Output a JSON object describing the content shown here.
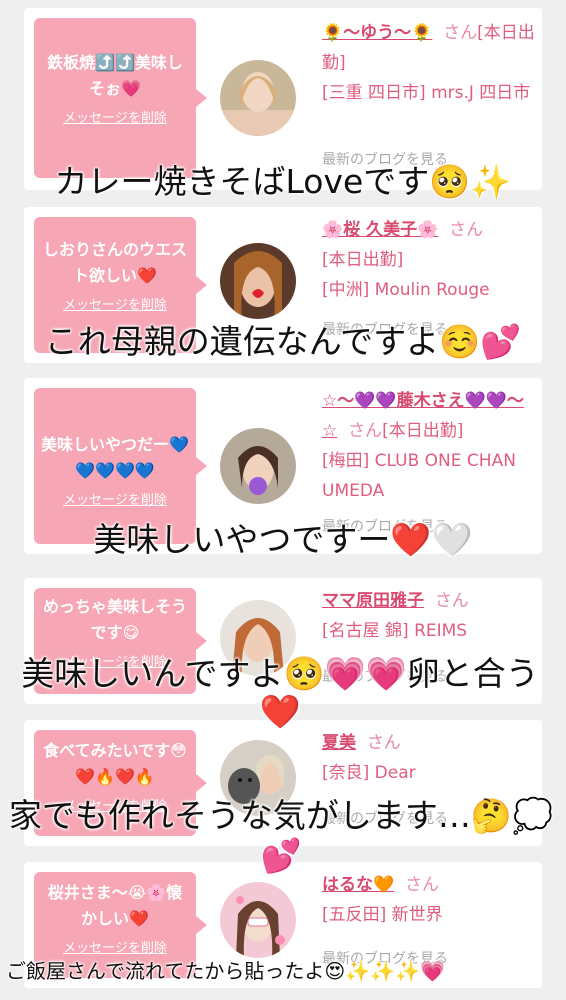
{
  "cards": [
    {
      "comment": "鉄板焼⤴️⤴️美味しそぉ💗",
      "delete_label": "メッセージを削除",
      "name": "🌻〜ゆう〜🌻",
      "honorific": "さん",
      "status": "[本日出勤]",
      "location": "[三重 四日市] mrs.J 四日市",
      "blog_link": "最新のブログを見る"
    },
    {
      "comment": "しおりさんのウエスト欲しい❤️",
      "delete_label": "メッセージを削除",
      "name": "🌸桜 久美子🌸",
      "honorific": "さん",
      "status": "[本日出勤]",
      "location": "[中洲] Moulin Rouge",
      "blog_link": "最新のブログを見る"
    },
    {
      "comment": "美味しいやつだー💙💙💙💙💙",
      "delete_label": "メッセージを削除",
      "name": "☆〜💜💜藤木さえ💜💜〜☆",
      "honorific": "さん",
      "status": "[本日出勤]",
      "location": "[梅田] CLUB ONE CHAN UMEDA",
      "blog_link": "最新のブログを見る"
    },
    {
      "comment": "めっちゃ美味しそうです😋",
      "delete_label": "メッセージを削除",
      "name": "ママ原田雅子",
      "honorific": "さん",
      "status": "",
      "location": "[名古屋 錦] REIMS",
      "blog_link": "最新のブログを見る"
    },
    {
      "comment": "食べてみたいです😳❤️🔥❤️🔥",
      "delete_label": "メッセージを削除",
      "name": "夏美",
      "honorific": "さん",
      "status": "",
      "location": "[奈良] Dear",
      "blog_link": "最新のブログを見る"
    },
    {
      "comment": "桜井さま〜😭🌸懐かしい❤️",
      "delete_label": "メッセージを削除",
      "name": "はるな🧡",
      "honorific": "さん",
      "status": "",
      "location": "[五反田] 新世界",
      "blog_link": "最新のブログを見る"
    }
  ],
  "captions": [
    "カレー焼きそばLoveです🥺✨",
    "これ母親の遺伝なんですよ☺️💕",
    "美味しいやつですー❤️🤍",
    "美味しいんですよ🥺💗💗卵と合う❤️",
    "家でも作れそうな気がします…🤔💭💕",
    "ご飯屋さんで流れてたから貼ったよ😍✨✨✨💗"
  ],
  "colors": {
    "bubble": "#f6a6b4",
    "name": "#d84a6f",
    "text_pink": "#e05d7f",
    "background": "#efefef"
  }
}
